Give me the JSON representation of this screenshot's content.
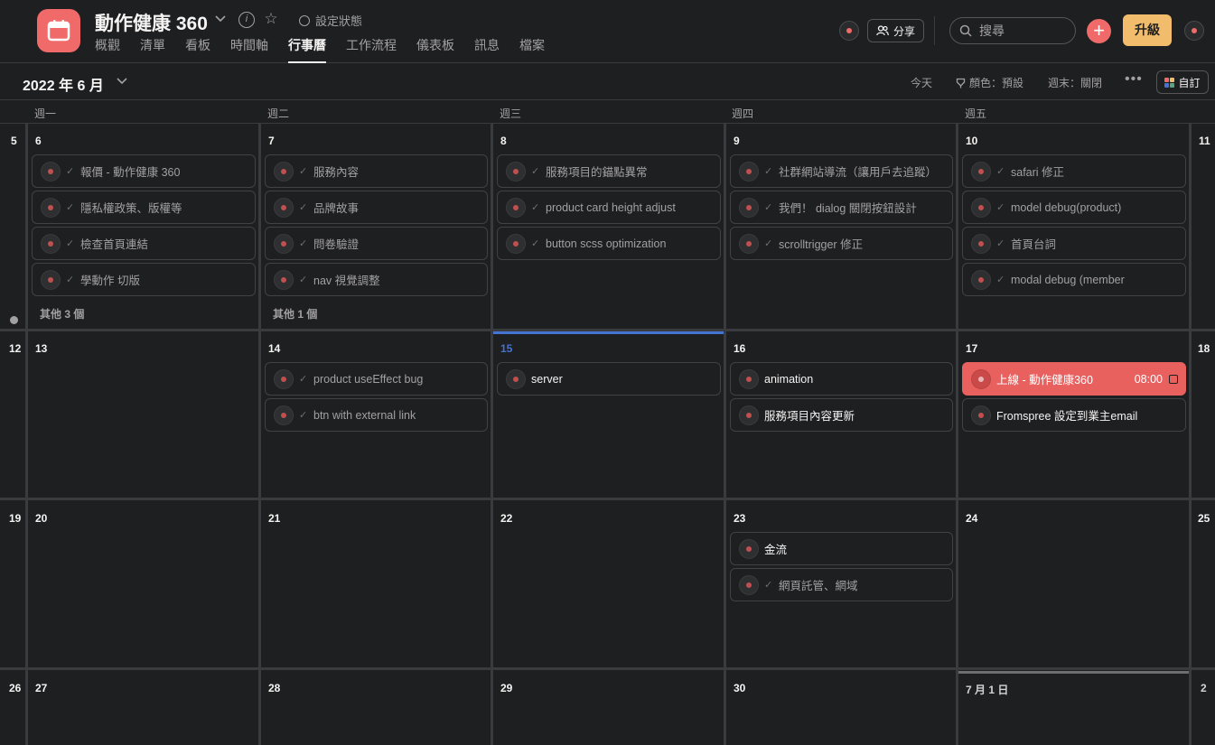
{
  "project": {
    "title": "動作健康 360",
    "status_label": "設定狀態",
    "tabs": [
      "概觀",
      "清單",
      "看板",
      "時間軸",
      "行事曆",
      "工作流程",
      "儀表板",
      "訊息",
      "檔案"
    ],
    "active_tab": "行事曆"
  },
  "header_actions": {
    "share_label": "分享",
    "search_placeholder": "搜尋",
    "add_label": "+",
    "upgrade_label": "升級"
  },
  "toolbar": {
    "month_label": "2022 年 6 月",
    "today_label": "今天",
    "color_label": "顏色：預設",
    "weekend_label": "週末：關閉",
    "customize_label": "自訂"
  },
  "weekdays": [
    "週一",
    "週二",
    "週三",
    "週四",
    "週五"
  ],
  "weeks": [
    {
      "week_num": "5",
      "end_num": "11",
      "days": [
        {
          "label": "6",
          "tasks": [
            "報價 - 動作健康 360",
            "隱私權政策、版權等",
            "檢查首頁連結",
            "學動作 切版"
          ],
          "more": "其他 3 個"
        },
        {
          "label": "7",
          "tasks": [
            "服務內容",
            "品牌故事",
            "問卷驗證",
            "nav 視覺調整"
          ],
          "more": "其他 1 個"
        },
        {
          "label": "8",
          "tasks": [
            "服務項目的錨點異常",
            "product card height adjust",
            "button scss optimization"
          ]
        },
        {
          "label": "9",
          "tasks": [
            "社群網站導流（讓用戶去追蹤）",
            "我們！ dialog 關閉按鈕設計",
            "scrolltrigger 修正"
          ]
        },
        {
          "label": "10",
          "tasks": [
            "safari 修正",
            "model debug(product)",
            "首頁台詞",
            "modal debug (member"
          ]
        }
      ]
    },
    {
      "week_num": "12",
      "end_num": "18",
      "days": [
        {
          "label": "13",
          "tasks": []
        },
        {
          "label": "14",
          "tasks": [
            "product useEffect bug",
            "btn with external link"
          ]
        },
        {
          "label": "15",
          "open_tasks": [
            "server"
          ]
        },
        {
          "label": "16",
          "open_tasks": [
            "animation",
            "服務項目內容更新"
          ]
        },
        {
          "label": "17",
          "highlight_task": {
            "label": "上線 - 動作健康360",
            "time": "08:00"
          },
          "open_tasks": [
            "Fromspree 設定到業主email"
          ]
        }
      ]
    },
    {
      "week_num": "19",
      "end_num": "25",
      "days": [
        {
          "label": "20"
        },
        {
          "label": "21"
        },
        {
          "label": "22"
        },
        {
          "label": "23",
          "open_tasks": [
            "金流"
          ],
          "tasks": [
            "網頁託管、網域"
          ]
        },
        {
          "label": "24"
        }
      ]
    },
    {
      "week_num": "26",
      "end_num": "2",
      "days": [
        {
          "label": "27"
        },
        {
          "label": "28"
        },
        {
          "label": "29"
        },
        {
          "label": "30"
        },
        {
          "label": "7 月 1 日"
        }
      ]
    }
  ],
  "colors": {
    "accent_red": "#f06a6a",
    "today_blue": "#4573d2",
    "upgrade_gold": "#f1bd6c"
  }
}
